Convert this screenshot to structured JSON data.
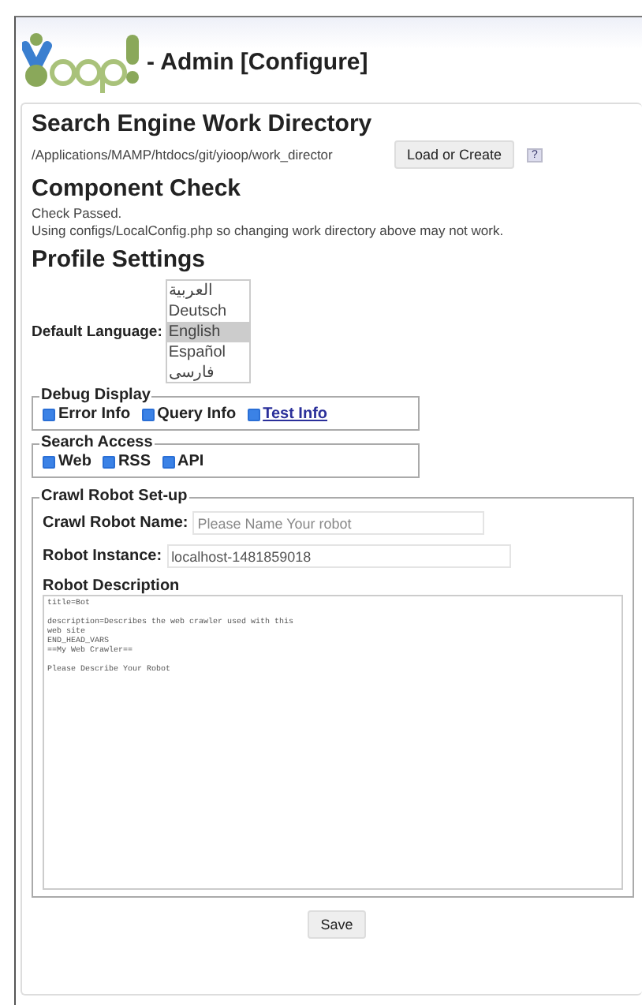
{
  "header": {
    "title": "- Admin [Configure]"
  },
  "work_directory": {
    "heading": "Search Engine Work Directory",
    "value": "/Applications/MAMP/htdocs/git/yioop/work_director",
    "button": "Load or Create",
    "help": "?"
  },
  "component_check": {
    "heading": "Component Check",
    "messages": [
      "Check Passed.",
      "Using configs/LocalConfig.php so changing work directory above may not work."
    ]
  },
  "profile": {
    "heading": "Profile Settings",
    "language_label": "Default Language:",
    "languages": [
      {
        "label": "العربية",
        "selected": false
      },
      {
        "label": "Deutsch",
        "selected": false
      },
      {
        "label": "English",
        "selected": true
      },
      {
        "label": "Español",
        "selected": false
      },
      {
        "label": "فارسی",
        "selected": false
      }
    ]
  },
  "debug_display": {
    "legend": "Debug Display",
    "options": [
      {
        "label": "Error Info",
        "checked": true,
        "kind": "plain"
      },
      {
        "label": "Query Info",
        "checked": true,
        "kind": "plain"
      },
      {
        "label": "Test Info",
        "checked": true,
        "kind": "link"
      }
    ]
  },
  "search_access": {
    "legend": "Search Access",
    "options": [
      {
        "label": "Web",
        "checked": true
      },
      {
        "label": "RSS",
        "checked": true
      },
      {
        "label": "API",
        "checked": true
      }
    ]
  },
  "crawl_robot": {
    "legend": "Crawl Robot Set-up",
    "name_label": "Crawl Robot Name:",
    "name_placeholder": "Please Name Your robot",
    "instance_label": "Robot Instance:",
    "instance_value": "localhost-1481859018",
    "description_label": "Robot Description",
    "description_value": "title=Bot\n\ndescription=Describes the web crawler used with this\nweb site\nEND_HEAD_VARS\n==My Web Crawler==\n\nPlease Describe Your Robot"
  },
  "save_button": "Save"
}
